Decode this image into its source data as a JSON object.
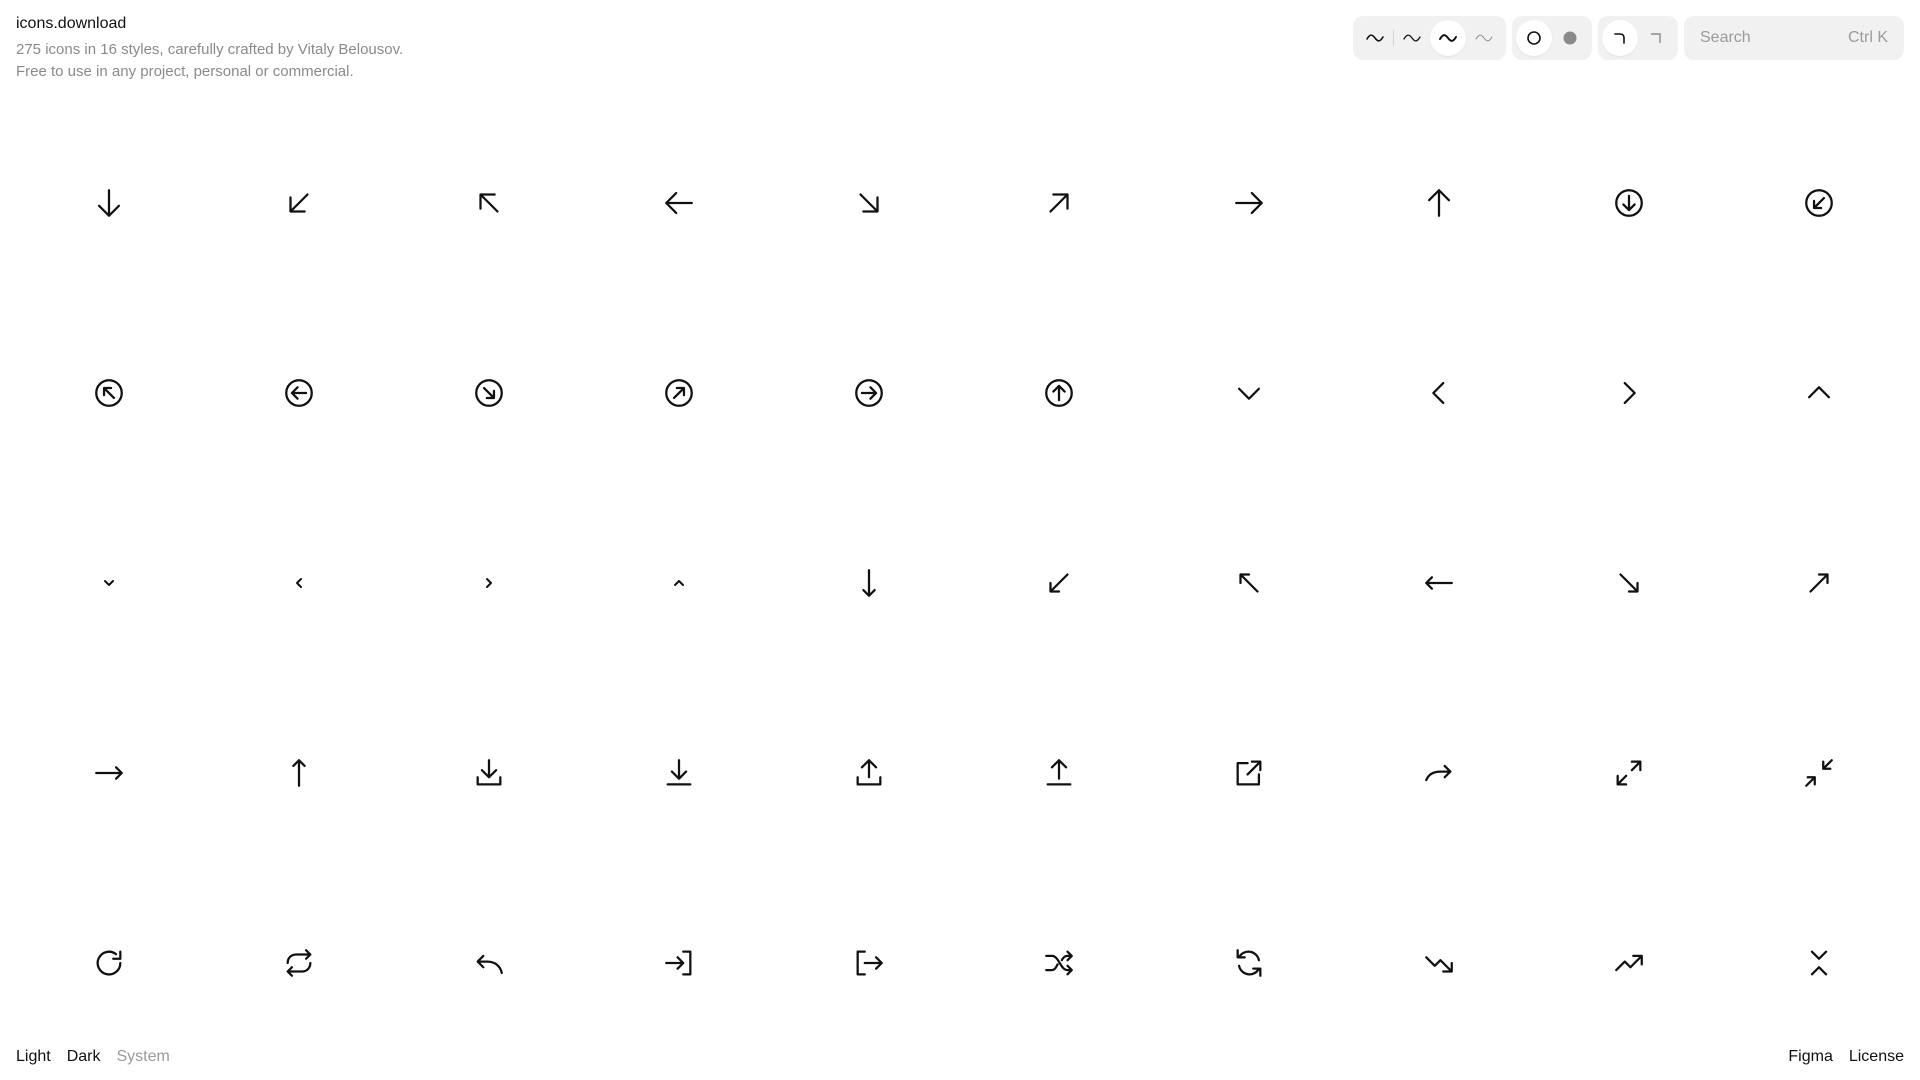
{
  "header": {
    "title": "icons.download",
    "tagline_line1": "275 icons in 16 styles, carefully crafted by Vitaly Belousov.",
    "tagline_line2": "Free to use in any project, personal or commercial."
  },
  "toolbar": {
    "weights": [
      "stroke-weight-1-icon",
      "stroke-weight-2-icon",
      "stroke-weight-3-icon",
      "stroke-weight-4-icon"
    ],
    "active_weight": 3,
    "fill_styles": [
      "outline-circle-icon",
      "filled-circle-icon"
    ],
    "active_fill": 1,
    "corner_styles": [
      "rounded-corner-icon",
      "sharp-corner-icon"
    ],
    "active_corner": 1
  },
  "search": {
    "placeholder": "Search",
    "shortcut": "Ctrl K"
  },
  "icons": [
    "arrow-down-icon",
    "arrow-down-left-icon",
    "arrow-up-left-icon",
    "arrow-left-icon",
    "arrow-down-right-icon",
    "arrow-up-right-icon",
    "arrow-right-icon",
    "arrow-up-icon",
    "arrow-down-circle-icon",
    "arrow-down-left-circle-icon",
    "arrow-up-left-circle-icon",
    "arrow-left-circle-icon",
    "arrow-down-right-circle-icon",
    "arrow-up-right-circle-icon",
    "arrow-right-circle-icon",
    "arrow-up-circle-icon",
    "chevron-down-icon",
    "chevron-left-icon",
    "chevron-right-icon",
    "chevron-up-icon",
    "chevron-down-small-icon",
    "chevron-left-small-icon",
    "chevron-right-small-icon",
    "chevron-up-small-icon",
    "arrow-down-thin-icon",
    "arrow-down-left-thin-icon",
    "arrow-up-left-thin-icon",
    "arrow-left-thin-icon",
    "arrow-down-right-thin-icon",
    "arrow-up-right-thin-icon",
    "arrow-right-thin-icon",
    "arrow-up-thin-icon",
    "download-tray-icon",
    "download-line-icon",
    "upload-tray-icon",
    "upload-line-icon",
    "external-link-icon",
    "redo-arrow-icon",
    "expand-icon",
    "collapse-icon",
    "rotate-cw-icon",
    "repeat-icon",
    "undo-arrow-icon",
    "login-icon",
    "logout-icon",
    "shuffle-icon",
    "refresh-icon",
    "trend-down-icon",
    "trend-up-icon",
    "collapse-vertical-icon"
  ],
  "footer": {
    "theme_light": "Light",
    "theme_dark": "Dark",
    "theme_system": "System",
    "figma": "Figma",
    "license": "License"
  },
  "colors": {
    "text": "#111111",
    "muted": "#9a9a9a",
    "control_bg": "#f1f1f1"
  }
}
